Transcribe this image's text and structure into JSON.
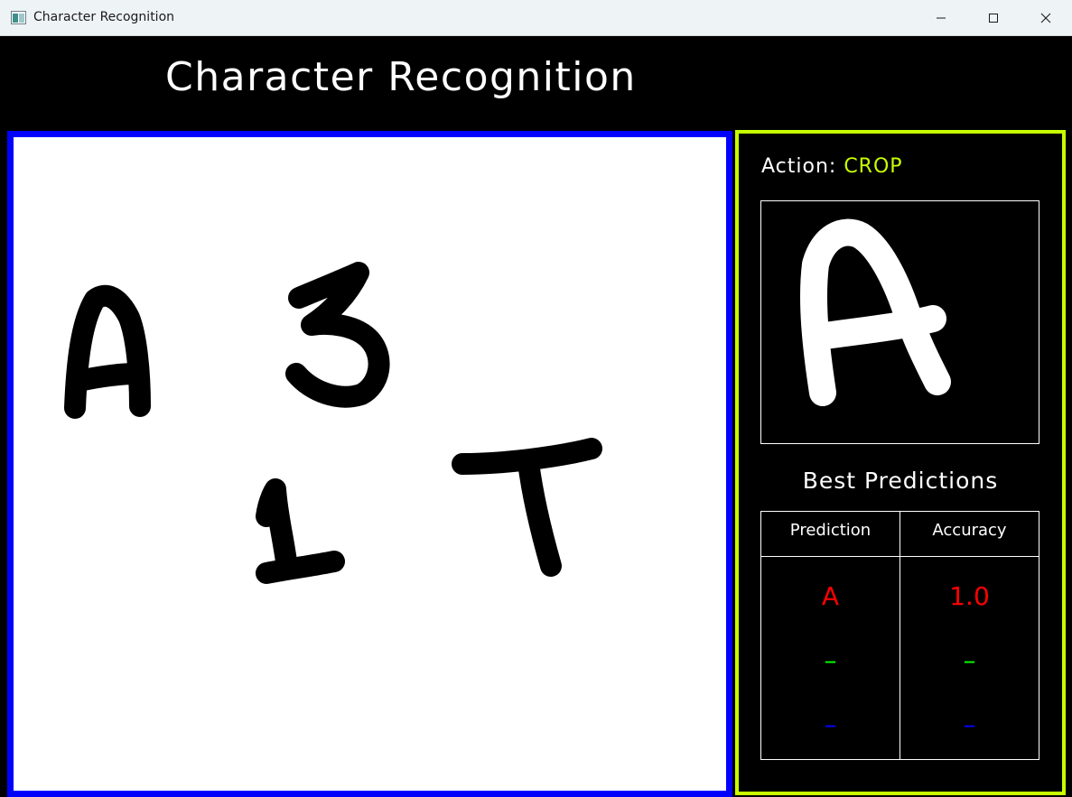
{
  "window": {
    "title": "Character Recognition"
  },
  "heading": "Character Recognition",
  "panel": {
    "action_label": "Action:",
    "action_value": "CROP",
    "best_predictions_title": "Best Predictions",
    "table": {
      "headers": [
        "Prediction",
        "Accuracy"
      ],
      "rows": [
        {
          "prediction": "A",
          "accuracy": "1.0",
          "color": "#ff0000"
        },
        {
          "prediction": "–",
          "accuracy": "–",
          "color": "#00ff00"
        },
        {
          "prediction": "–",
          "accuracy": "–",
          "color": "#0000ff"
        }
      ]
    }
  },
  "colors": {
    "canvas_border": "#0000ff",
    "panel_border": "#c8ff00",
    "action_value": "#c8ff00"
  },
  "icons": [
    "app-icon",
    "minimize-icon",
    "maximize-icon",
    "close-icon"
  ]
}
